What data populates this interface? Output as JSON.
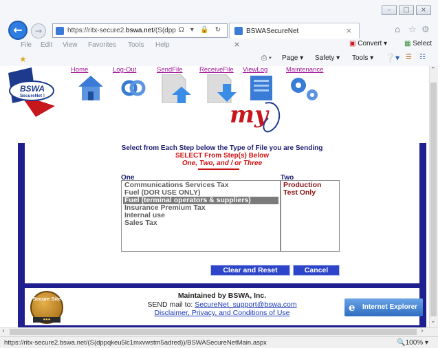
{
  "browser": {
    "address": {
      "scheme": "https://",
      "host_pre": "ritx-secure2.",
      "host_bold": "bswa.net",
      "path": "/(S(dpp",
      "controls": "Ω ▾ 🔒 ↻"
    },
    "tab": {
      "title": "BSWASecureNet",
      "close": "×"
    },
    "tab_close": "×",
    "menu": [
      "File",
      "Edit",
      "View",
      "Favorites",
      "Tools",
      "Help"
    ],
    "command_bar": {
      "convert": "Convert",
      "select": "Select",
      "page": "Page",
      "safety": "Safety",
      "tools": "Tools"
    },
    "status_url": "https://ritx-secure2.bswa.net/(S(dppqkeu5lc1mxvwstm5adred))/BSWASecureNetMain.aspx",
    "zoom": "100%"
  },
  "header": {
    "nav_links": [
      "Home",
      "Log-Out",
      "SendFile",
      "ReceiveFile",
      "ViewLog",
      "Maintenance"
    ],
    "logo_text": "BSWA",
    "logo_sub": "SecureNet !"
  },
  "form": {
    "instruction_1": "Select from Each Step below the Type of File you are Sending",
    "instruction_2": "SELECT From Step(s) Below",
    "instruction_3": "One, Two, and / or Three",
    "step_one_label": "One",
    "step_two_label": "Two",
    "step_one_options": [
      "Communications Services Tax",
      "Fuel (DOR USE ONLY)",
      "Fuel (terminal operators & suppliers)",
      "Insurance Premium Tax",
      "Internal use",
      "Sales Tax"
    ],
    "step_one_selected_index": 2,
    "step_two_options": [
      "Production",
      "Test Only"
    ],
    "clear_button": "Clear and Reset",
    "cancel_button": "Cancel"
  },
  "footer": {
    "maintained": "Maintained by BSWA, Inc.",
    "send_mail_prefix": "SEND mail to: ",
    "email": "SecureNet_support@bswa.com",
    "disclaimer": "Disclaimer, Privacy, and Conditions of Use",
    "seal_text": "Secure Site",
    "ie_logo": "Internet Explorer"
  },
  "colors": {
    "frame_blue": "#1f1f8f",
    "instruction_blue": "#1c1c70",
    "instruction_red": "#d01212",
    "button_blue": "#2d45c8",
    "link_purple": "#a0149a"
  }
}
